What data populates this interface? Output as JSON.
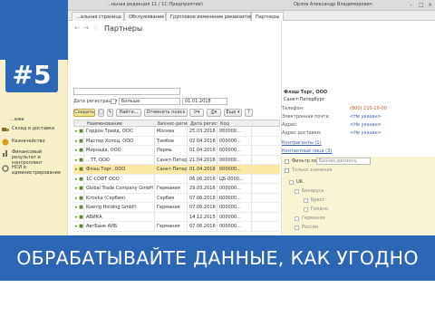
{
  "window": {
    "title": "...ньная редакция 11 / 1С:Предприятие)",
    "user": "Орлов Александр Владимирович"
  },
  "episode_badge": "#5",
  "sidebar": {
    "items": [
      {
        "label": "Склад и доставка",
        "icon": "truck-icon"
      },
      {
        "label": "Казначейство",
        "icon": "money-icon"
      },
      {
        "label": "Финансовый результат и контроллинг",
        "icon": "chart-icon"
      },
      {
        "label": "НСИ и администрирование",
        "icon": "gear-icon"
      }
    ],
    "partial_item": "...ажи"
  },
  "tabs": [
    "...альная страница",
    "Обслуживание",
    "Групповое изменение реквизитов",
    "Партнеры"
  ],
  "page": {
    "title": "Партнеры",
    "filter_label": "Дата регистрации",
    "filter_op": "Больше",
    "filter_date": "01.01.2018",
    "buttons": {
      "create": "Создать",
      "find": "Найти...",
      "cancel_search": "Отменить поиск",
      "more": "Еще"
    }
  },
  "grid": {
    "columns": [
      "",
      "Наименование",
      "Бизнес-регион",
      "Дата регистрации",
      "Код"
    ],
    "rows": [
      {
        "name": "Гордон Трейд, ООО",
        "region": "Москва",
        "date": "25.03.2016",
        "code": "000000..."
      },
      {
        "name": "Мастер Холод, ООО",
        "region": "Тамбов",
        "date": "02.04.2016",
        "code": "000000..."
      },
      {
        "name": "Мирнада, ООО",
        "region": "Пермь",
        "date": "01.04.2016",
        "code": "000000..."
      },
      {
        "name": "...ТТ, ООО",
        "region": "Санкт-Петер...",
        "date": "21.04.2016",
        "code": "000000..."
      },
      {
        "name": "Флэш Торг, ООО",
        "region": "Санкт-Петер...",
        "date": "01.04.2016",
        "code": "000000...",
        "selected": true
      },
      {
        "name": "1С-СОФТ ООО",
        "region": "",
        "date": "06.06.2016",
        "code": "ЦБ-0000..."
      },
      {
        "name": "Global Trade Company GmbH",
        "region": "Германия",
        "date": "29.03.2016",
        "code": "000000..."
      },
      {
        "name": "Kirovka (Сербия)",
        "region": "Сербия",
        "date": "07.06.2016",
        "code": "000000..."
      },
      {
        "name": "Koenig Holding GmbH",
        "region": "Германия",
        "date": "07.06.2016",
        "code": "000000..."
      },
      {
        "name": "АВИКА",
        "region": "",
        "date": "14.12.2015",
        "code": "000000..."
      },
      {
        "name": "АвтБанк АИБ",
        "region": "Германия",
        "date": "07.06.2016",
        "code": "000000..."
      }
    ]
  },
  "detail": {
    "company": "Флэш Торг, ООО",
    "city": "Санкт-Петербург",
    "phone_label": "Телефон:",
    "phone": "(800) 210-10-00",
    "email_label": "Электронная почта:",
    "email": "<Не указан>",
    "address_label": "Адрес:",
    "address": "<Не указан>",
    "delivery_label": "Адрес доставки:",
    "delivery": "<Не указан>",
    "contracts": "Контрагенты (1)",
    "contacts": "Контактные лица (3)",
    "filter_label": "Фильтр по:",
    "filter_value": "Бизнес-региону",
    "only_values": "Только значения",
    "tree": [
      "UK",
      "Беларусь",
      "Брест",
      "Гродно",
      "Германия",
      "Россия"
    ]
  },
  "banner": "ОБРАБАТЫВАЙТЕ ДАННЫЕ, КАК УГОДНО",
  "colors": {
    "accent": "#2b67b4",
    "sidebar": "#f5f0c8",
    "selected_row": "#fae8a3"
  }
}
